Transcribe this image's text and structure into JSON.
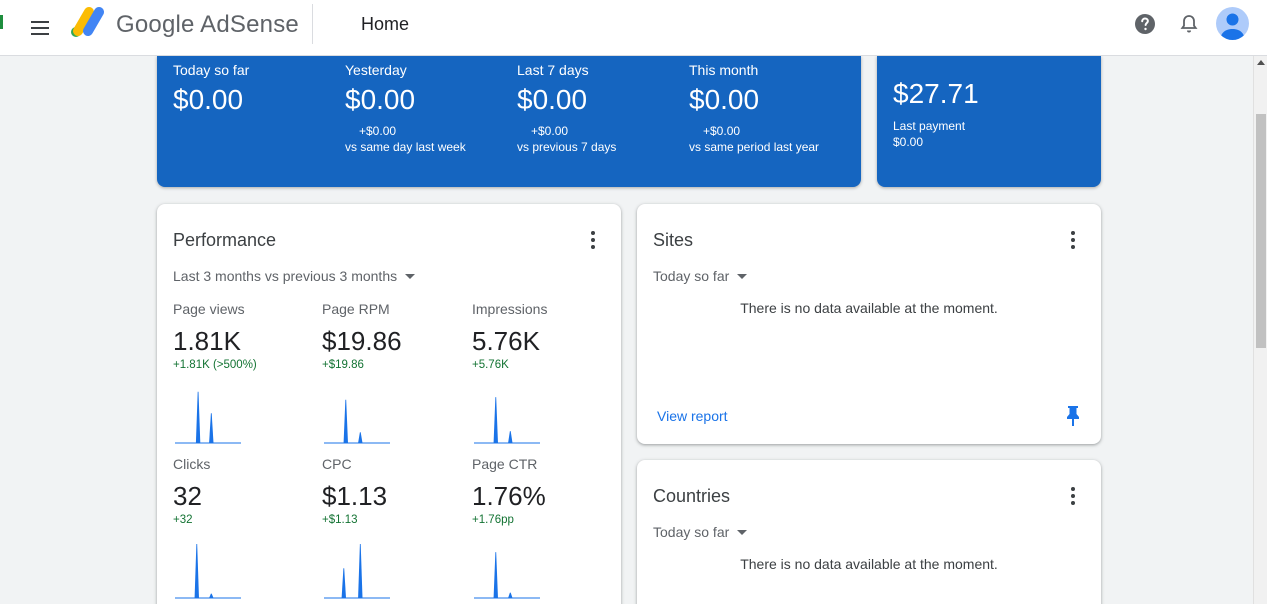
{
  "app": {
    "brand": "Google AdSense",
    "page_title": "Home",
    "icons": [
      "menu-icon",
      "adsense-logo-icon",
      "help-icon",
      "notifications-icon",
      "account-avatar"
    ]
  },
  "colors": {
    "summary_blue": "#1565c0",
    "positive_delta": "#137333",
    "link_blue": "#1a73e8",
    "chart_blue": "#1a73e8"
  },
  "earnings": [
    {
      "label": "Today so far",
      "value": "$0.00",
      "delta": "",
      "comparison": ""
    },
    {
      "label": "Yesterday",
      "value": "$0.00",
      "delta": "+$0.00",
      "comparison": "vs same day last week"
    },
    {
      "label": "Last 7 days",
      "value": "$0.00",
      "delta": "+$0.00",
      "comparison": "vs previous 7 days"
    },
    {
      "label": "This month",
      "value": "$0.00",
      "delta": "+$0.00",
      "comparison": "vs same period last year"
    }
  ],
  "payment": {
    "balance": "$27.71",
    "last_payment_label": "Last payment",
    "last_payment_value": "$0.00"
  },
  "performance": {
    "title": "Performance",
    "range": "Last 3 months vs previous 3 months",
    "metrics": [
      {
        "label": "Page views",
        "value": "1.81K",
        "delta": "+1.81K (>500%)",
        "spikes": [
          {
            "pos": 0.35,
            "h": 0.95
          },
          {
            "pos": 0.55,
            "h": 0.55
          }
        ]
      },
      {
        "label": "Page RPM",
        "value": "$19.86",
        "delta": "+$19.86",
        "spikes": [
          {
            "pos": 0.33,
            "h": 0.8
          },
          {
            "pos": 0.55,
            "h": 0.2
          }
        ]
      },
      {
        "label": "Impressions",
        "value": "5.76K",
        "delta": "+5.76K",
        "spikes": [
          {
            "pos": 0.33,
            "h": 0.85
          },
          {
            "pos": 0.55,
            "h": 0.22
          }
        ]
      },
      {
        "label": "Clicks",
        "value": "32",
        "delta": "+32",
        "spikes": [
          {
            "pos": 0.33,
            "h": 1.0
          },
          {
            "pos": 0.55,
            "h": 0.08
          }
        ]
      },
      {
        "label": "CPC",
        "value": "$1.13",
        "delta": "+$1.13",
        "spikes": [
          {
            "pos": 0.3,
            "h": 0.55
          },
          {
            "pos": 0.55,
            "h": 1.0
          }
        ]
      },
      {
        "label": "Page CTR",
        "value": "1.76%",
        "delta": "+1.76pp",
        "spikes": [
          {
            "pos": 0.33,
            "h": 0.85
          },
          {
            "pos": 0.55,
            "h": 0.1
          }
        ]
      }
    ]
  },
  "sites": {
    "title": "Sites",
    "range": "Today so far",
    "empty_message": "There is no data available at the moment.",
    "link": "View report"
  },
  "countries": {
    "title": "Countries",
    "range": "Today so far",
    "empty_message": "There is no data available at the moment."
  }
}
